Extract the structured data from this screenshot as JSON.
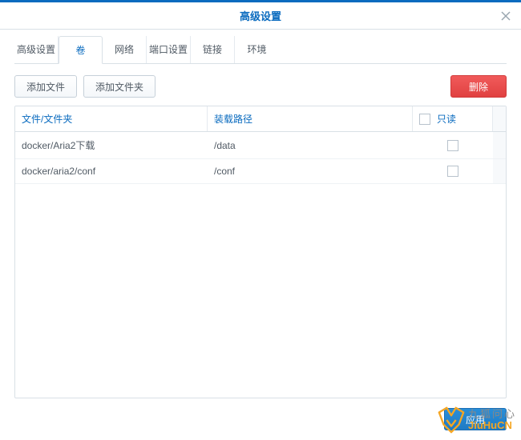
{
  "dialog": {
    "title": "高级设置"
  },
  "tabs": [
    {
      "label": "高级设置",
      "active": false
    },
    {
      "label": "卷",
      "active": true
    },
    {
      "label": "网络",
      "active": false
    },
    {
      "label": "端口设置",
      "active": false
    },
    {
      "label": "链接",
      "active": false
    },
    {
      "label": "环境",
      "active": false
    }
  ],
  "toolbar": {
    "add_file_label": "添加文件",
    "add_folder_label": "添加文件夹",
    "delete_label": "删除"
  },
  "table": {
    "columns": {
      "file": "文件/文件夹",
      "path": "装载路径",
      "readonly": "只读"
    },
    "rows": [
      {
        "file": "docker/Aria2下载",
        "path": "/data",
        "readonly": false
      },
      {
        "file": "docker/aria2/conf",
        "path": "/conf",
        "readonly": false
      }
    ]
  },
  "footer": {
    "apply_label": "应用"
  },
  "watermark": {
    "cn": "九狐问心",
    "en": "JiuHuCN"
  }
}
